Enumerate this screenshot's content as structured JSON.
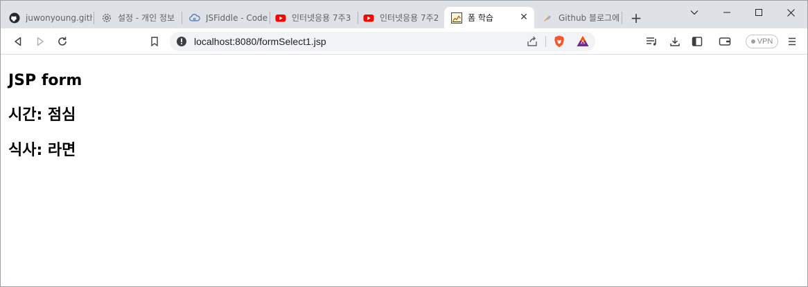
{
  "tabs": [
    {
      "title": "juwonyoung.gith",
      "icon": "github-icon",
      "active": false
    },
    {
      "title": "설정 - 개인 정보",
      "icon": "gear-icon",
      "active": false
    },
    {
      "title": "JSFiddle - Code",
      "icon": "jsfiddle-icon",
      "active": false
    },
    {
      "title": "인터넷응용 7주3",
      "icon": "youtube-icon",
      "active": false
    },
    {
      "title": "인터넷응용 7주2",
      "icon": "youtube-icon",
      "active": false
    },
    {
      "title": "폼 학습",
      "icon": "page-favicon-icon",
      "active": true
    },
    {
      "title": "Github 블로그에",
      "icon": "feather-icon",
      "active": false
    }
  ],
  "new_tab_label": "+",
  "close_tab_label": "✕",
  "toolbar": {
    "url": "localhost:8080/formSelect1.jsp",
    "vpn_label": "VPN"
  },
  "page": {
    "heading": "JSP form",
    "time_line": "시간: 점심",
    "meal_line": "식사: 라면"
  },
  "colors": {
    "tabstrip_bg": "#dee1e6",
    "youtube_red": "#ff0000",
    "brave_orange": "#fb542b"
  }
}
